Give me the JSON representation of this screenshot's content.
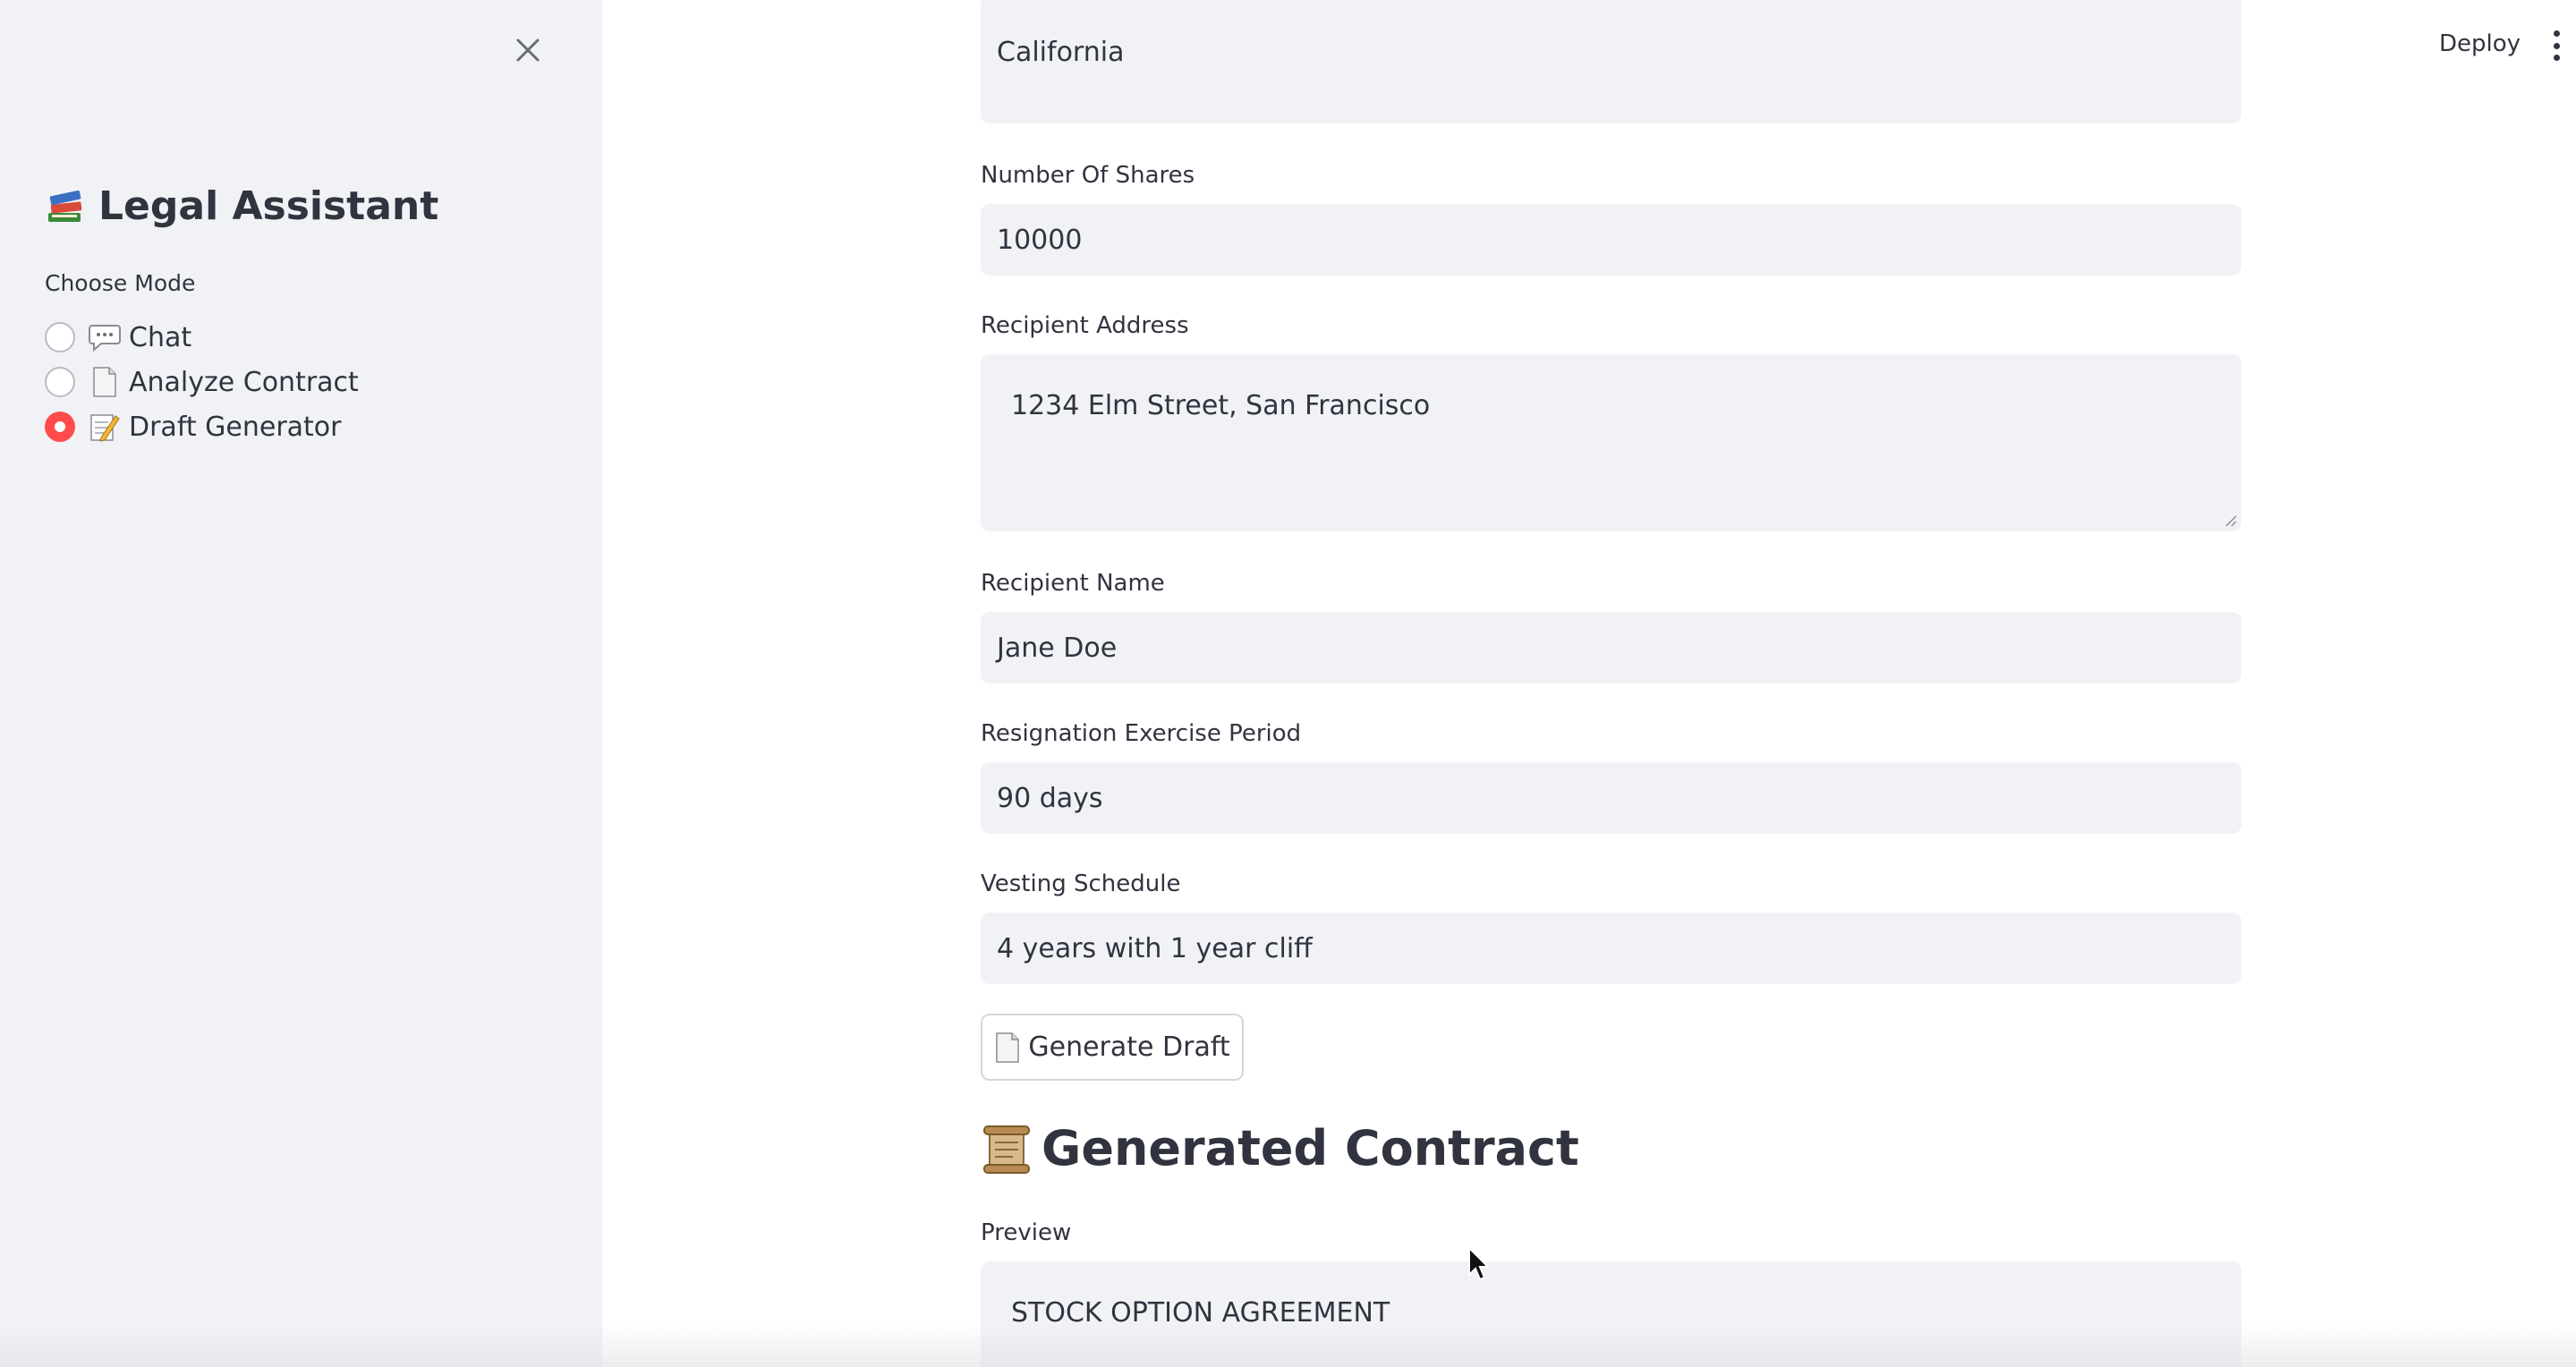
{
  "sidebar": {
    "title": "Legal Assistant",
    "title_icon": "books-icon",
    "mode_label": "Choose Mode",
    "modes": [
      {
        "label": "Chat",
        "icon": "speech-bubble-icon",
        "selected": false
      },
      {
        "label": "Analyze Contract",
        "icon": "document-icon",
        "selected": false
      },
      {
        "label": "Draft Generator",
        "icon": "memo-icon",
        "selected": true
      }
    ],
    "accent_color": "#ff4b4b"
  },
  "header": {
    "deploy_label": "Deploy"
  },
  "form": {
    "state_value": "California",
    "shares_label": "Number Of Shares",
    "shares_value": "10000",
    "address_label": "Recipient Address",
    "address_value": "1234 Elm Street, San Francisco",
    "name_label": "Recipient Name",
    "name_value": "Jane Doe",
    "exercise_label": "Resignation Exercise Period",
    "exercise_value": "90 days",
    "vesting_label": "Vesting Schedule",
    "vesting_value": "4 years with 1 year cliff",
    "generate_button": "Generate Draft"
  },
  "result": {
    "heading": "Generated Contract",
    "heading_icon": "scroll-icon",
    "preview_label": "Preview",
    "preview_text": "STOCK OPTION AGREEMENT"
  }
}
